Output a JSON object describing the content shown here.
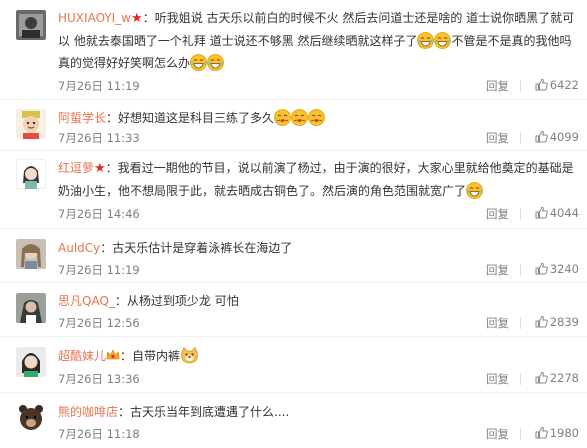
{
  "comments": [
    {
      "user": "HUXIAOYI_w",
      "text_parts": [
        "：听我姐说 古天乐以前白的时候不火 然后去问道士还是啥的 道士说你晒黑了就可以 他就去泰国晒了一个礼拜 道士说还不够黑 然后继续晒就这样子了",
        "不管是不是真的我他吗真的觉得好好笑啊怎么办"
      ],
      "date": "7月26日 11:19",
      "reply": "回复",
      "likes": "6422"
    },
    {
      "user": "阿蜇学长",
      "text_parts": [
        "：好想知道这是科目三练了多久"
      ],
      "date": "7月26日 11:33",
      "reply": "回复",
      "likes": "4099"
    },
    {
      "user": "红逗萝",
      "text_parts": [
        "：我看过一期他的节目，说以前演了杨过，由于演的很好，大家心里就给他奠定的基础是奶油小生，他不想局限于此，就去晒成古铜色了。然后演的角色范围就宽广了"
      ],
      "date": "7月26日 14:46",
      "reply": "回复",
      "likes": "4044"
    },
    {
      "user": "AuldCy",
      "text_parts": [
        "：古天乐估计是穿着泳裤长在海边了"
      ],
      "date": "7月26日 11:19",
      "reply": "回复",
      "likes": "3240"
    },
    {
      "user": "思凡QAQ_",
      "text_parts": [
        "：从杨过到项少龙 可怕"
      ],
      "date": "7月26日 12:56",
      "reply": "回复",
      "likes": "2839"
    },
    {
      "user": "超酷妹儿",
      "text_parts": [
        "：自带内裤"
      ],
      "date": "7月26日 13:36",
      "reply": "回复",
      "likes": "2278"
    },
    {
      "user": "熊的咖啡店",
      "text_parts": [
        "：古天乐当年到底遭遇了什么...."
      ],
      "date": "7月26日 11:18",
      "reply": "回复",
      "likes": "1980"
    }
  ],
  "colors": {
    "username": "#eb7350",
    "text": "#333333",
    "meta": "#808080",
    "badge_star": "#e0281e"
  },
  "icons": {
    "like": "thumbs-up-icon",
    "badge": "red-star-icon",
    "vip": "vip-crown-icon",
    "emoji": "laughing-emoji",
    "emoji_alt": "giggle-emoji",
    "emoji_dog": "doge-emoji"
  }
}
